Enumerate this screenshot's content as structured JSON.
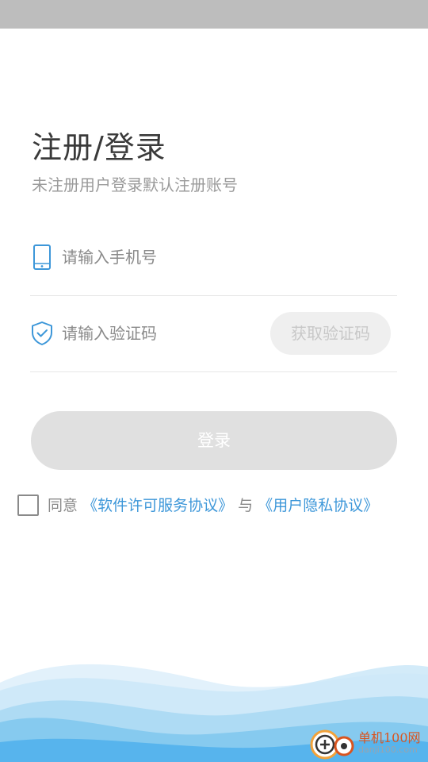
{
  "page": {
    "title": "注册/登录",
    "subtitle": "未注册用户登录默认注册账号"
  },
  "phone_field": {
    "icon": "mobile-phone-icon",
    "placeholder": "请输入手机号",
    "value": ""
  },
  "code_field": {
    "icon": "shield-check-icon",
    "placeholder": "请输入验证码",
    "value": "",
    "get_code_label": "获取验证码"
  },
  "login_button_label": "登录",
  "agreement": {
    "checked": false,
    "prefix": "同意",
    "software_license_link": "《软件许可服务协议》",
    "connector": "与",
    "privacy_link": "《用户隐私协议》"
  },
  "watermark": {
    "site_name": "单机100网",
    "site_domain": "danji100.com"
  },
  "colors": {
    "accent": "#3d97d9",
    "disabled_button": "#e0e0e0",
    "status_bar": "#bdbdbd"
  }
}
